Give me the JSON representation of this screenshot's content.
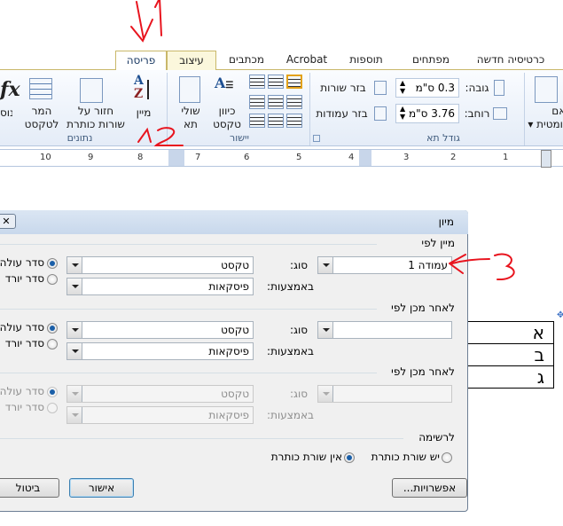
{
  "ribbon": {
    "tabs": [
      {
        "label": "פריסה",
        "active": true
      },
      {
        "label": "עיצוב"
      },
      {
        "label": "מכתבים"
      },
      {
        "label": "Acrobat"
      },
      {
        "label": "תוספות"
      },
      {
        "label": "מפתחים"
      },
      {
        "label": "כרטיסיה חדשה"
      }
    ],
    "groups": {
      "data": {
        "label": "נתונים",
        "sort": "מיין",
        "repeat_header_1": "חזור על",
        "repeat_header_2": "שורות כותרת",
        "convert_1": "המר",
        "convert_2": "לטקסט",
        "formula": "נוס"
      },
      "alignment": {
        "label": "יישור",
        "text_direction_1": "כיוון",
        "text_direction_2": "טקסט",
        "cell_margins_1": "שולי",
        "cell_margins_2": "תא"
      },
      "cell_size": {
        "label": "גודל תא",
        "height_label": "גובה:",
        "height_value": "0.3 ס\"מ",
        "width_label": "רוחב:",
        "width_value": "3.76 ס\"מ",
        "distribute_rows": "בזר שורות",
        "distribute_columns": "בזר עמודות"
      },
      "autofit": {
        "label_1": "התאם",
        "label_2": "אוטומטית"
      }
    }
  },
  "ruler": {
    "numbers": [
      "10",
      "9",
      "8",
      "7",
      "6",
      "5",
      "4",
      "3",
      "2",
      "1"
    ]
  },
  "dialog": {
    "title": "מיון",
    "sort_by": {
      "label": "מיין לפי",
      "column": "עמודה 1",
      "type_label": "סוג:",
      "type": "טקסט",
      "using_label": "באמצעות:",
      "using": "פיסקאות",
      "ascending": "סדר עולה",
      "descending": "סדר יורד",
      "order": "ascending"
    },
    "then_by_1": {
      "label": "לאחר מכן לפי",
      "column": "",
      "type_label": "סוג:",
      "type": "טקסט",
      "using_label": "באמצעות:",
      "using": "פיסקאות",
      "ascending": "סדר עולה",
      "descending": "סדר יורד",
      "order": "ascending"
    },
    "then_by_2": {
      "label": "לאחר מכן לפי",
      "column": "",
      "type_label": "סוג:",
      "type": "טקסט",
      "using_label": "באמצעות:",
      "using": "פיסקאות",
      "ascending": "סדר עולה",
      "descending": "סדר יורד",
      "disabled": true
    },
    "list": {
      "label": "לרשימה",
      "header_row": "יש שורת כותרת",
      "no_header_row": "אין שורת כותרת",
      "selected": "no_header_row"
    },
    "buttons": {
      "options": "אפשרויות...",
      "ok": "אישור",
      "cancel": "ביטול"
    }
  },
  "table": {
    "rows": [
      "א",
      "ב",
      "ג"
    ]
  },
  "annotations": {
    "colors": {
      "ink": "#e8141e"
    },
    "marks": [
      "1",
      "2",
      "3"
    ]
  }
}
